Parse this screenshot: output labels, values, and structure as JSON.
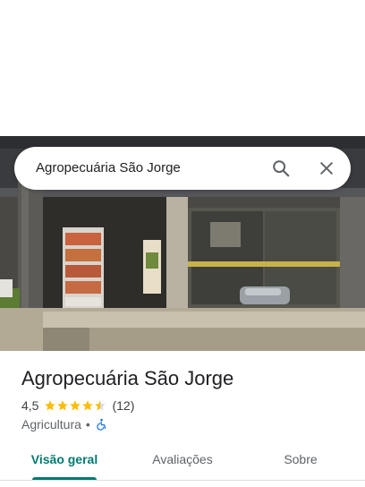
{
  "search": {
    "query": "Agropecuária São Jorge"
  },
  "place": {
    "name": "Agropecuária São Jorge",
    "rating": "4,5",
    "review_count": "(12)",
    "rating_stars": 4.5,
    "category": "Agricultura",
    "separator": "•"
  },
  "tabs": [
    {
      "label": "Visão geral",
      "selected": true
    },
    {
      "label": "Avaliações",
      "selected": false
    },
    {
      "label": "Sobre",
      "selected": false
    }
  ],
  "icons": {
    "search": "search-icon",
    "close": "close-icon",
    "accessibility": "wheelchair-icon"
  },
  "colors": {
    "accent": "#01796f",
    "star": "#fbbc04",
    "accessibility": "#1a73e8"
  }
}
